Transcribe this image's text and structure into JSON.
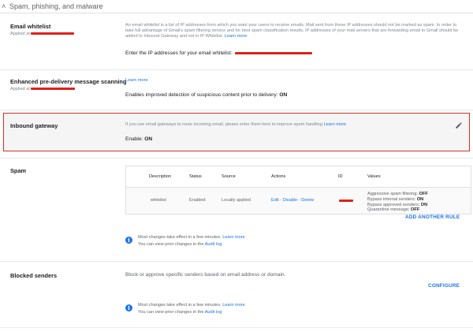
{
  "header": {
    "title": "Spam, phishing, and malware"
  },
  "email_whitelist": {
    "title": "Email whitelist",
    "applied_at": "Applied at",
    "description": "An email whitelist is a list of IP addresses from which you want your users to receive emails. Mail sent from these IP addresses should not be marked as spam. In order to take full advantage of Gmail's spam filtering service and for best spam classification results, IP addresses of your mail servers that are forwarding email to Gmail should be added to Inbound Gateway and not in IP Whitelist.",
    "learn_more": "Learn more",
    "setting_label": "Enter the IP addresses for your email whitelist:"
  },
  "enhanced_scanning": {
    "title": "Enhanced pre-delivery message scanning",
    "applied_at": "Applied at",
    "learn_more": "Learn more",
    "setting_label": "Enables improved detection of suspicious content prior to delivery:",
    "setting_value": "ON"
  },
  "inbound_gateway": {
    "title": "Inbound gateway",
    "description": "If you use email gateways to route incoming email, please enter them here to improve spam handling",
    "learn_more": "Learn more",
    "setting_label": "Enable:",
    "setting_value": "ON"
  },
  "spam": {
    "title": "Spam",
    "columns": [
      "Description",
      "Status",
      "Source",
      "Actions",
      "ID",
      "Values"
    ],
    "row": {
      "description": "whitelist",
      "status": "Enabled",
      "source": "Locally applied",
      "action_edit": "Edit",
      "action_sep1": " - ",
      "action_disable": "Disable",
      "action_sep2": " - ",
      "action_delete": "Delete",
      "values": [
        {
          "label": "Aggressive spam filtering:",
          "value": "OFF"
        },
        {
          "label": "Bypass internal senders:",
          "value": "ON"
        },
        {
          "label": "Bypass approved senders:",
          "value": "ON"
        },
        {
          "label": "Quarantine message:",
          "value": "OFF"
        }
      ]
    },
    "add_rule": "ADD ANOTHER RULE",
    "info_line1": "Most changes take effect in a few minutes.",
    "info_learn_more": "Learn more",
    "info_line2": "You can view prior changes in the",
    "info_audit_log": "Audit log"
  },
  "blocked_senders": {
    "title": "Blocked senders",
    "description": "Block or approve specific senders based on email address or domain.",
    "configure": "CONFIGURE",
    "info_line1": "Most changes take effect in a few minutes.",
    "info_learn_more": "Learn more",
    "info_line2": "You can view prior changes in the",
    "info_audit_log": "Audit log"
  },
  "colors": {
    "accent": "#1a73e8",
    "highlight_border": "#d93025",
    "redaction": "#e0201b"
  },
  "icons": {
    "collapse": "chevron-up-icon",
    "edit": "pencil-icon",
    "info": "info-icon"
  }
}
